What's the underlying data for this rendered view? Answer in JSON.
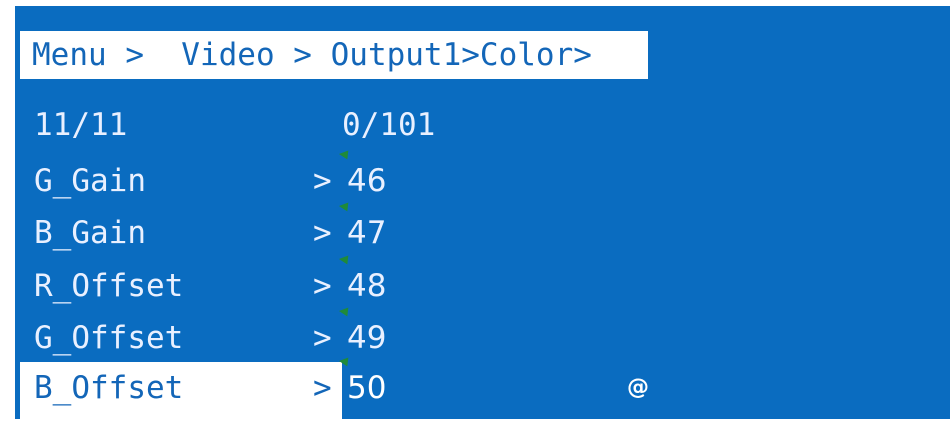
{
  "breadcrumb": {
    "text": "Menu >  Video > Output1>Color>"
  },
  "counter": {
    "position": "11/11",
    "range": "0/101"
  },
  "items": [
    {
      "label": "G_Gain",
      "chevron": ">",
      "value": "46"
    },
    {
      "label": "B_Gain",
      "chevron": ">",
      "value": "47"
    },
    {
      "label": "R_Offset",
      "chevron": ">",
      "value": "48"
    },
    {
      "label": "G_Offset",
      "chevron": ">",
      "value": "49"
    },
    {
      "label": "B_Offset",
      "chevron": ">",
      "value": "50",
      "extra": "@"
    }
  ],
  "colors": {
    "background": "#0a6cc0",
    "highlight": "#ffffff",
    "text": "#e9f0ff",
    "accent_tick": "#1f8a3a"
  }
}
